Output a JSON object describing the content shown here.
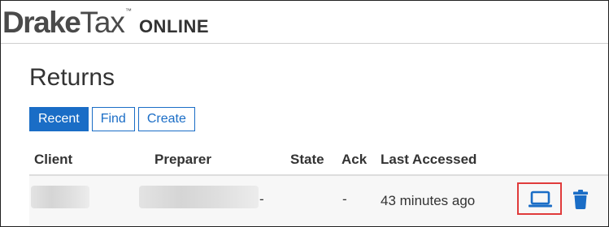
{
  "brand": {
    "name_bold": "Drake",
    "name_regular": "Tax",
    "trademark": "™",
    "product": "ONLINE"
  },
  "page": {
    "title": "Returns"
  },
  "tabs": [
    {
      "label": "Recent",
      "active": true
    },
    {
      "label": "Find",
      "active": false
    },
    {
      "label": "Create",
      "active": false
    }
  ],
  "table": {
    "columns": [
      "Client",
      "Preparer",
      "State",
      "Ack",
      "Last Accessed"
    ],
    "rows": [
      {
        "client": "",
        "preparer": "",
        "state": "-",
        "ack": "-",
        "last_accessed": "43 minutes ago",
        "actions": [
          "laptop-icon",
          "trash-icon"
        ]
      }
    ]
  },
  "colors": {
    "accent": "#1a6dc6",
    "highlight": "#e03b3b",
    "text": "#333333"
  }
}
